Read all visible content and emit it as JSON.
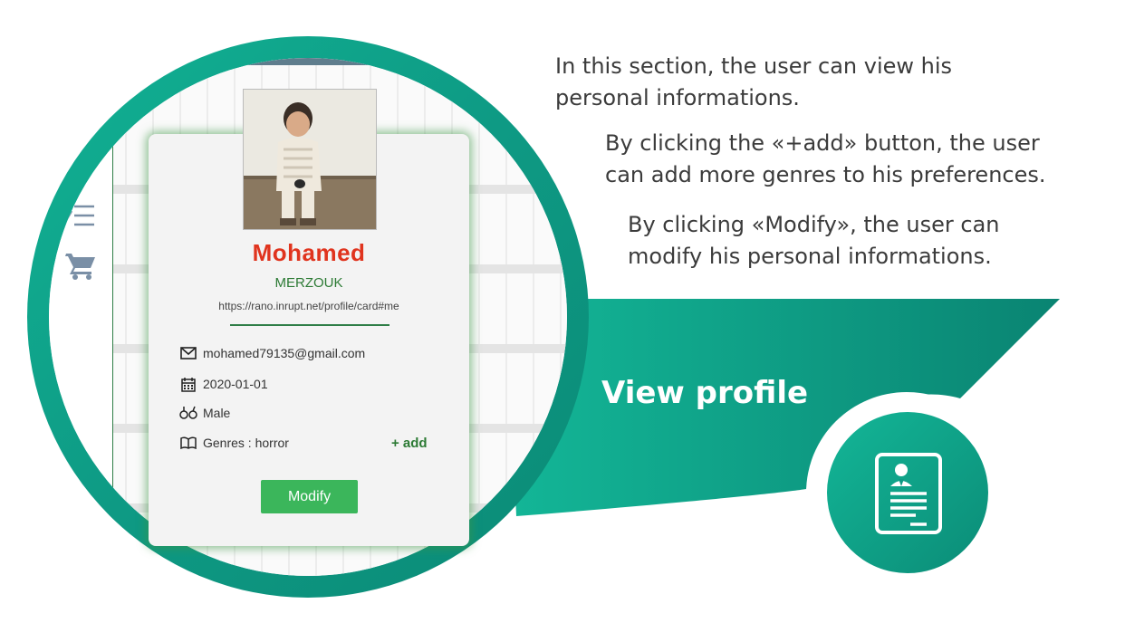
{
  "colors": {
    "teal_light": "#11b294",
    "teal_dark": "#0b8a76",
    "first_name": "#e0341e",
    "green_text": "#2c7a34",
    "button": "#3bb65b"
  },
  "descriptions": {
    "line1a": "In this section, the user can view his",
    "line1b": "personal informations.",
    "line2a": "By clicking the «+add» button, the user",
    "line2b": "can add more genres to his preferences.",
    "line3a": "By clicking «Modify», the user can",
    "line3b": "modify his personal informations."
  },
  "ribbon": {
    "label": "View profile",
    "icon": "profile-document-icon"
  },
  "sidebar": {
    "icons": [
      "list-icon",
      "shopping-cart-icon"
    ]
  },
  "profile": {
    "photo_icon": "profile-photo",
    "first_name": "Mohamed",
    "last_name": "MERZOUK",
    "webid": "https://rano.inrupt.net/profile/card#me",
    "email": "mohamed79135@gmail.com",
    "birthdate": "2020-01-01",
    "gender": "Male",
    "genres": "Genres : horror",
    "add_label": "+ add",
    "modify_label": "Modify"
  }
}
